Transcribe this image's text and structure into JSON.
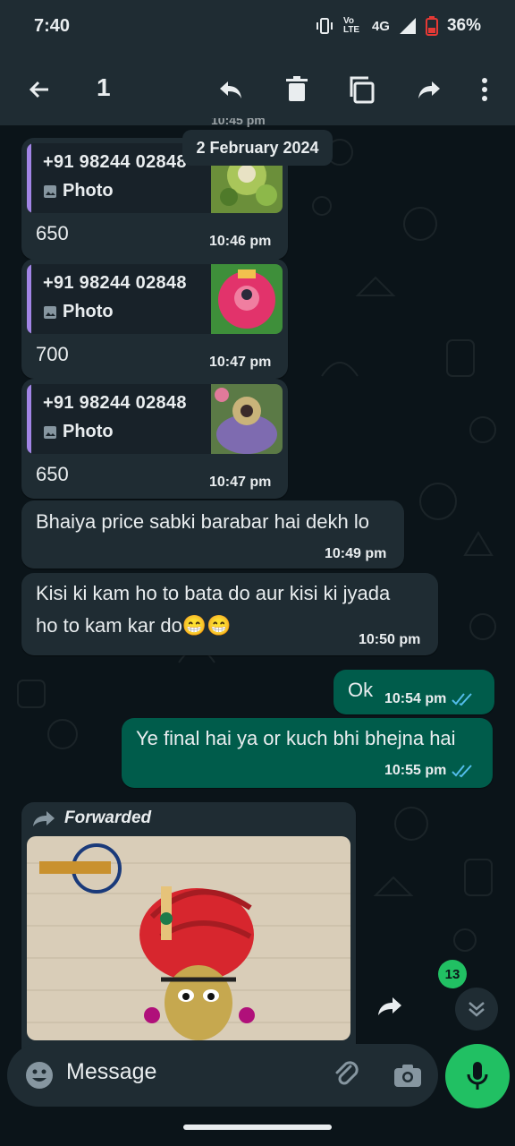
{
  "status_bar": {
    "time": "7:40",
    "network": "4G",
    "volte": "Vo LTE",
    "battery": "36%"
  },
  "toolbar": {
    "selected_count": "1"
  },
  "date_chip": "2 February 2024",
  "partial_time": "10:45 pm",
  "messages": [
    {
      "quote_name": "+91 98244 02848",
      "quote_type": "Photo",
      "text": "650",
      "time": "10:46 pm"
    },
    {
      "quote_name": "+91 98244 02848",
      "quote_type": "Photo",
      "text": "700",
      "time": "10:47 pm"
    },
    {
      "quote_name": "+91 98244 02848",
      "quote_type": "Photo",
      "text": "650",
      "time": "10:47 pm"
    },
    {
      "text": "Bhaiya price sabki barabar hai dekh lo",
      "time": "10:49 pm"
    },
    {
      "text_line1": "Kisi ki kam ho to bata do aur kisi ki jyada",
      "text_line2": "ho to kam kar do😁😁",
      "time": "10:50 pm"
    },
    {
      "text": "Ok",
      "time": "10:54 pm",
      "status": "read"
    },
    {
      "text": "Ye final hai ya or kuch bhi bhejna hai",
      "time": "10:55 pm",
      "status": "read"
    }
  ],
  "forwarded": {
    "label": "Forwarded"
  },
  "unread_badge": "13",
  "composer": {
    "placeholder": "Message"
  },
  "colors": {
    "bg": "#0b1419",
    "bar": "#1f2c33",
    "incoming": "#1f2c33",
    "outgoing": "#005c4b",
    "accent": "#21c063",
    "read_ticks": "#53bdeb",
    "quote_bar": "#a285e6"
  }
}
